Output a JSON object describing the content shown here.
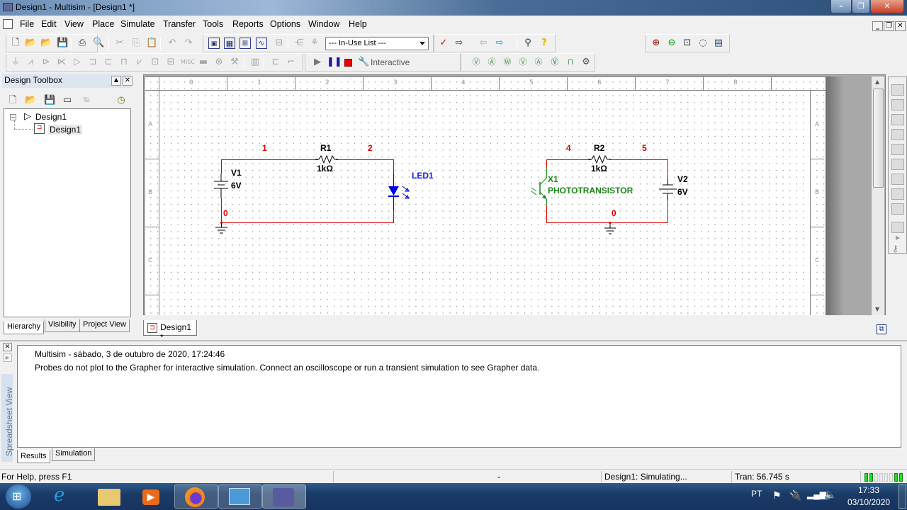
{
  "window": {
    "title": "Design1 - Multisim - [Design1 *]",
    "controls": {
      "minimize": "–",
      "restore": "❐",
      "close": "✕"
    },
    "mdi_controls": {
      "minimize": "_",
      "restore": "❐",
      "close": "✕"
    }
  },
  "menu": [
    "File",
    "Edit",
    "View",
    "Place",
    "Simulate",
    "Transfer",
    "Tools",
    "Reports",
    "Options",
    "Window",
    "Help"
  ],
  "toolbar": {
    "in_use_list": "--- In-Use List ---",
    "interactive_label": "Interactive"
  },
  "design_toolbox": {
    "title": "Design Toolbox",
    "tree": [
      {
        "label": "Design1",
        "type": "root"
      },
      {
        "label": "Design1",
        "type": "sheet"
      }
    ],
    "tabs": [
      "Hierarchy",
      "Visibility",
      "Project View"
    ],
    "active_tab": "Hierarchy"
  },
  "workspace": {
    "ruler_columns": [
      "0",
      "1",
      "2",
      "3",
      "4",
      "5",
      "6",
      "7",
      "8"
    ],
    "ruler_rows": [
      "A",
      "B",
      "C"
    ],
    "tab": "Design1 *"
  },
  "schematic": {
    "circuit1": {
      "source": {
        "ref": "V1",
        "value": "6V"
      },
      "resistor": {
        "ref": "R1",
        "value": "1kΩ"
      },
      "led": {
        "ref": "LED1"
      },
      "nodes": [
        "1",
        "2",
        "0"
      ]
    },
    "circuit2": {
      "source": {
        "ref": "V2",
        "value": "6V"
      },
      "resistor": {
        "ref": "R2",
        "value": "1kΩ"
      },
      "phototransistor": {
        "ref": "X1",
        "type": "PHOTOTRANSISTOR"
      },
      "nodes": [
        "4",
        "5",
        "0"
      ]
    },
    "colors": {
      "wire": "#e00000",
      "led": "#0000e0",
      "phototransistor": "#1a8a1a"
    }
  },
  "spreadsheet": {
    "side_label": "Spreadsheet View",
    "messages": [
      "Multisim  -  sábado, 3 de outubro de 2020, 17:24:46",
      "Probes do not plot to the Grapher for interactive simulation. Connect an oscilloscope or run a transient simulation to see Grapher data."
    ],
    "tabs": [
      "Results",
      "Simulation"
    ],
    "active_tab": "Results"
  },
  "statusbar": {
    "help": "For Help, press F1",
    "dash": "-",
    "sim_status": "Design1: Simulating...",
    "tran": "Tran: 56.745 s"
  },
  "taskbar": {
    "language": "PT",
    "time": "17:33",
    "date": "03/10/2020"
  }
}
